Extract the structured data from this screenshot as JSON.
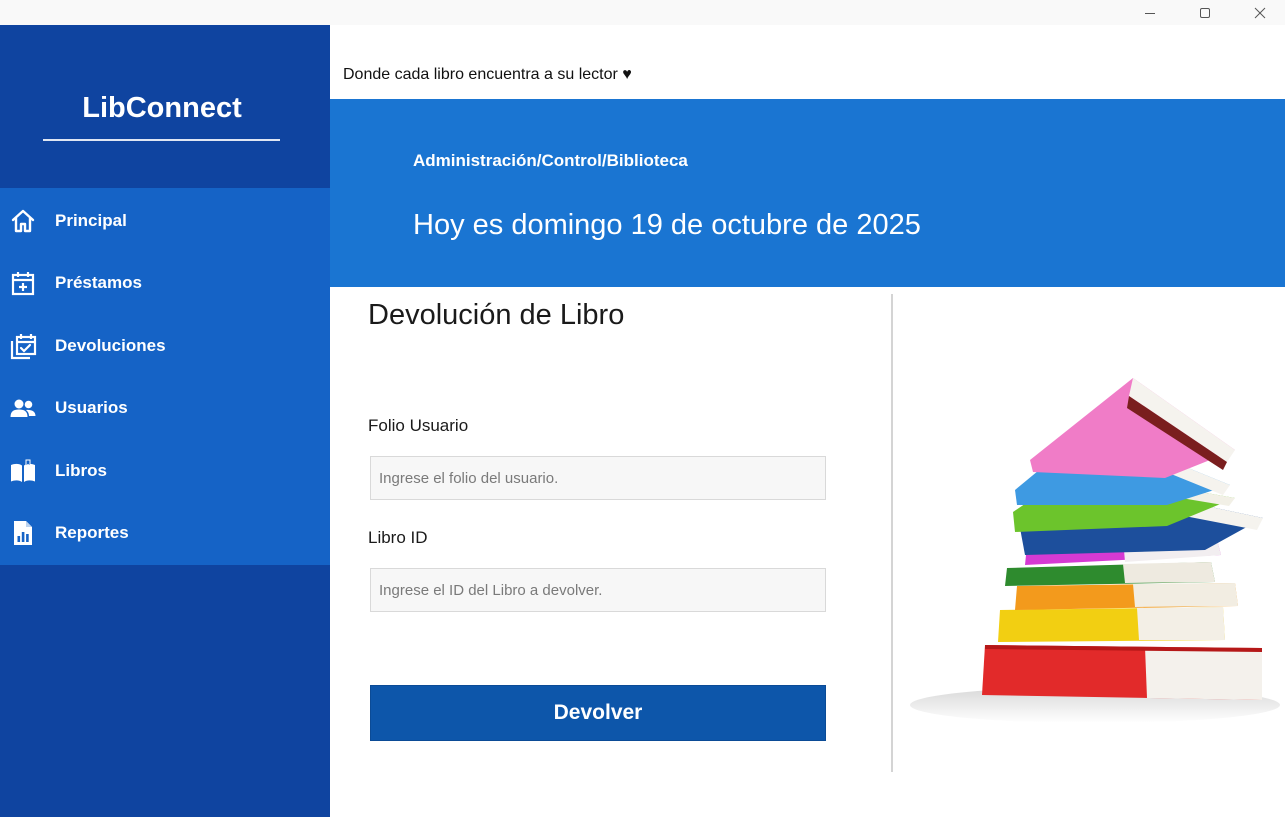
{
  "window": {
    "controls": {
      "minimize": "minimize-icon",
      "maximize": "maximize-icon",
      "close": "close-icon"
    }
  },
  "sidebar": {
    "brand": "LibConnect",
    "items": [
      {
        "label": "Principal",
        "icon": "home-icon"
      },
      {
        "label": "Préstamos",
        "icon": "calendar-add-icon"
      },
      {
        "label": "Devoluciones",
        "icon": "calendar-check-icon"
      },
      {
        "label": "Usuarios",
        "icon": "users-icon"
      },
      {
        "label": "Libros",
        "icon": "book-icon"
      },
      {
        "label": "Reportes",
        "icon": "report-icon"
      }
    ]
  },
  "top": {
    "tagline": "Donde cada libro encuentra a su lector ♥"
  },
  "header": {
    "breadcrumb": "Administración/Control/Biblioteca",
    "date": "Hoy es domingo 19 de octubre de 2025"
  },
  "form": {
    "title": "Devolución de Libro",
    "folio_label": "Folio Usuario",
    "folio_value": "",
    "folio_placeholder": "Ingrese el folio del usuario.",
    "libro_label": "Libro ID",
    "libro_value": "",
    "libro_placeholder": "Ingrese el ID del Libro a devolver.",
    "submit_label": "Devolver"
  },
  "colors": {
    "sidebar_dark": "#0f44a0",
    "sidebar_nav": "#1563c6",
    "header_blue": "#1a75d2",
    "button_blue": "#0d56aa"
  }
}
